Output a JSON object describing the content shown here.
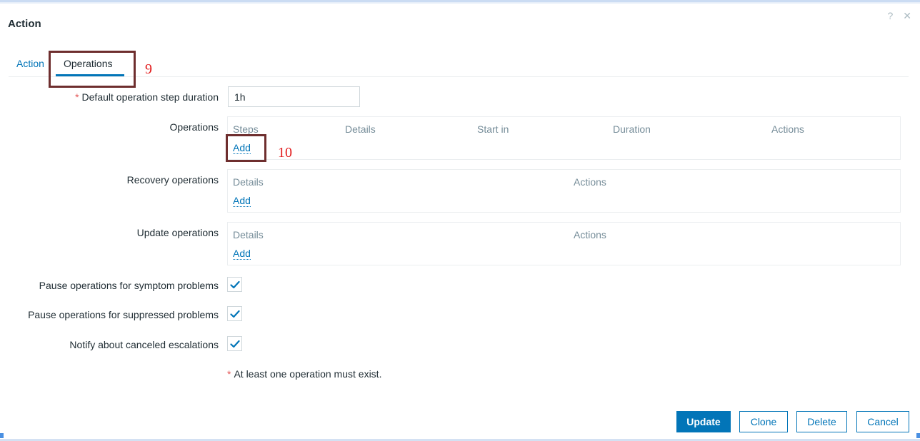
{
  "dialog": {
    "title": "Action",
    "help_icon": "?",
    "close_icon": "✕"
  },
  "tabs": [
    {
      "label": "Action",
      "active": false
    },
    {
      "label": "Operations",
      "active": true
    }
  ],
  "annotations": {
    "tab_marker": "9",
    "add_marker": "10"
  },
  "form": {
    "step_duration": {
      "required_mark": "*",
      "label": "Default operation step duration",
      "value": "1h"
    },
    "operations": {
      "label": "Operations",
      "columns": [
        "Steps",
        "Details",
        "Start in",
        "Duration",
        "Actions"
      ],
      "add_label": "Add"
    },
    "recovery_operations": {
      "label": "Recovery operations",
      "columns": [
        "Details",
        "Actions"
      ],
      "add_label": "Add"
    },
    "update_operations": {
      "label": "Update operations",
      "columns": [
        "Details",
        "Actions"
      ],
      "add_label": "Add"
    },
    "checkboxes": [
      {
        "label": "Pause operations for symptom problems",
        "checked": true
      },
      {
        "label": "Pause operations for suppressed problems",
        "checked": true
      },
      {
        "label": "Notify about canceled escalations",
        "checked": true
      }
    ],
    "note": {
      "required_mark": "*",
      "text": "At least one operation must exist."
    }
  },
  "buttons": {
    "update": "Update",
    "clone": "Clone",
    "delete": "Delete",
    "cancel": "Cancel"
  },
  "colors": {
    "accent": "#0275b8",
    "required": "#e45959",
    "annotation_box": "#6e2e2e",
    "annotation_text": "#e1191a"
  }
}
